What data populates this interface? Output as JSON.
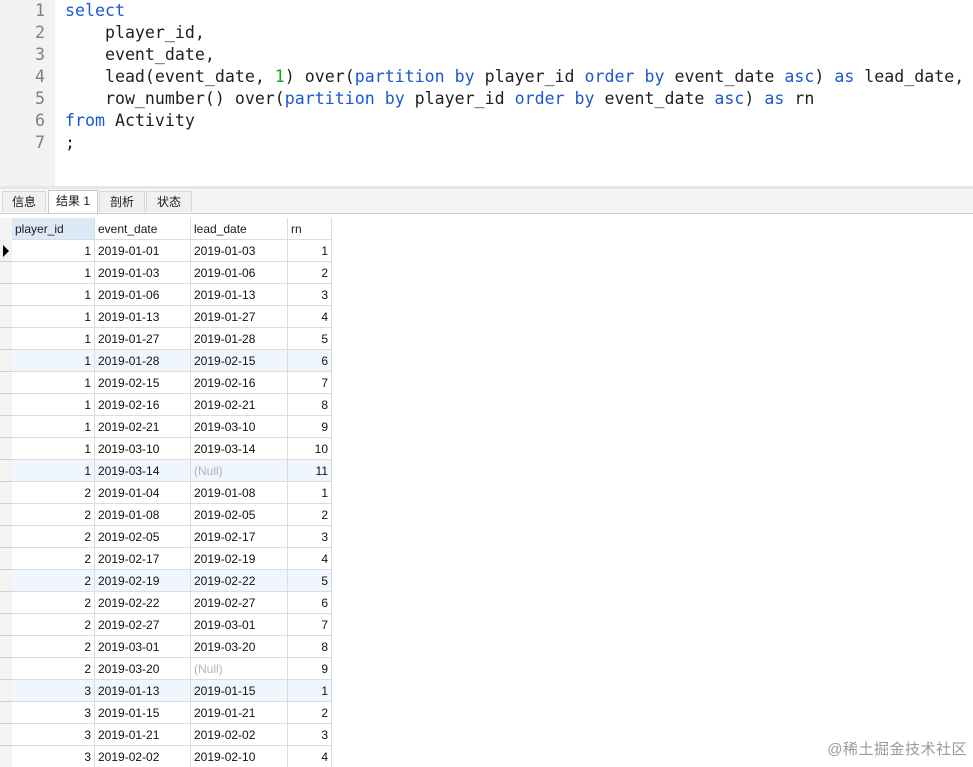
{
  "editor": {
    "lines": [
      {
        "n": "1",
        "parts": [
          {
            "t": "select",
            "k": "kw"
          }
        ]
      },
      {
        "n": "2",
        "parts": [
          {
            "t": "    player_id,",
            "k": ""
          }
        ]
      },
      {
        "n": "3",
        "parts": [
          {
            "t": "    event_date,",
            "k": ""
          }
        ]
      },
      {
        "n": "4",
        "parts": [
          {
            "t": "    lead(event_date, ",
            "k": ""
          },
          {
            "t": "1",
            "k": "num"
          },
          {
            "t": ") over(",
            "k": ""
          },
          {
            "t": "partition by",
            "k": "kw"
          },
          {
            "t": " player_id ",
            "k": ""
          },
          {
            "t": "order by",
            "k": "kw"
          },
          {
            "t": " event_date ",
            "k": ""
          },
          {
            "t": "asc",
            "k": "kw"
          },
          {
            "t": ") ",
            "k": ""
          },
          {
            "t": "as",
            "k": "kw"
          },
          {
            "t": " lead_date,",
            "k": ""
          }
        ]
      },
      {
        "n": "5",
        "parts": [
          {
            "t": "    row_number() over(",
            "k": ""
          },
          {
            "t": "partition by",
            "k": "kw"
          },
          {
            "t": " player_id ",
            "k": ""
          },
          {
            "t": "order by",
            "k": "kw"
          },
          {
            "t": " event_date ",
            "k": ""
          },
          {
            "t": "asc",
            "k": "kw"
          },
          {
            "t": ") ",
            "k": ""
          },
          {
            "t": "as",
            "k": "kw"
          },
          {
            "t": " rn",
            "k": ""
          }
        ]
      },
      {
        "n": "6",
        "parts": [
          {
            "t": "from",
            "k": "kw"
          },
          {
            "t": " Activity",
            "k": ""
          }
        ]
      },
      {
        "n": "7",
        "parts": [
          {
            "t": ";",
            "k": ""
          }
        ]
      }
    ]
  },
  "tabs": [
    "信息",
    "结果 1",
    "剖析",
    "状态"
  ],
  "active_tab": 1,
  "grid": {
    "columns": [
      "player_id",
      "event_date",
      "lead_date",
      "rn"
    ],
    "rows": [
      [
        "1",
        "2019-01-01",
        "2019-01-03",
        "1"
      ],
      [
        "1",
        "2019-01-03",
        "2019-01-06",
        "2"
      ],
      [
        "1",
        "2019-01-06",
        "2019-01-13",
        "3"
      ],
      [
        "1",
        "2019-01-13",
        "2019-01-27",
        "4"
      ],
      [
        "1",
        "2019-01-27",
        "2019-01-28",
        "5"
      ],
      [
        "1",
        "2019-01-28",
        "2019-02-15",
        "6"
      ],
      [
        "1",
        "2019-02-15",
        "2019-02-16",
        "7"
      ],
      [
        "1",
        "2019-02-16",
        "2019-02-21",
        "8"
      ],
      [
        "1",
        "2019-02-21",
        "2019-03-10",
        "9"
      ],
      [
        "1",
        "2019-03-10",
        "2019-03-14",
        "10"
      ],
      [
        "1",
        "2019-03-14",
        "(Null)",
        "11"
      ],
      [
        "2",
        "2019-01-04",
        "2019-01-08",
        "1"
      ],
      [
        "2",
        "2019-01-08",
        "2019-02-05",
        "2"
      ],
      [
        "2",
        "2019-02-05",
        "2019-02-17",
        "3"
      ],
      [
        "2",
        "2019-02-17",
        "2019-02-19",
        "4"
      ],
      [
        "2",
        "2019-02-19",
        "2019-02-22",
        "5"
      ],
      [
        "2",
        "2019-02-22",
        "2019-02-27",
        "6"
      ],
      [
        "2",
        "2019-02-27",
        "2019-03-01",
        "7"
      ],
      [
        "2",
        "2019-03-01",
        "2019-03-20",
        "8"
      ],
      [
        "2",
        "2019-03-20",
        "(Null)",
        "9"
      ],
      [
        "3",
        "2019-01-13",
        "2019-01-15",
        "1"
      ],
      [
        "3",
        "2019-01-15",
        "2019-01-21",
        "2"
      ],
      [
        "3",
        "2019-01-21",
        "2019-02-02",
        "3"
      ],
      [
        "3",
        "2019-02-02",
        "2019-02-10",
        "4"
      ]
    ],
    "null_text": "(Null)"
  },
  "watermark": "@稀土掘金技术社区",
  "colors": {
    "keyword": "#1a57d6",
    "number": "#13a313",
    "null": "#b4b4b4",
    "header_selected": "#dceaf8"
  }
}
